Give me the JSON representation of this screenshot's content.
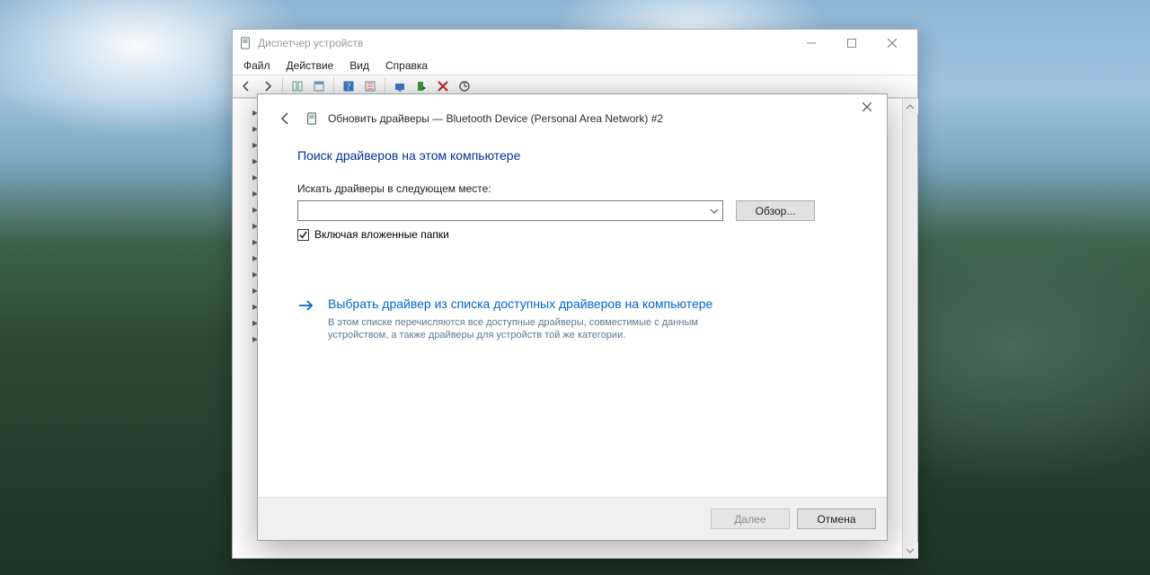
{
  "devmgr": {
    "title": "Диспетчер устройств",
    "menu": {
      "file": "Файл",
      "action": "Действие",
      "view": "Вид",
      "help": "Справка"
    }
  },
  "modal": {
    "header_prefix": "Обновить драйверы — ",
    "device_name": "Bluetooth Device (Personal Area Network) #2",
    "section_title": "Поиск драйверов на этом компьютере",
    "path_label": "Искать драйверы в следующем месте:",
    "path_value": "",
    "browse_label": "Обзор...",
    "include_subfolders_label": "Включая вложенные папки",
    "include_subfolders_checked": true,
    "option_title": "Выбрать драйвер из списка доступных драйверов на компьютере",
    "option_desc": "В этом списке перечисляются все доступные драйверы, совместимые с данным устройством, а также драйверы для устройств той же категории.",
    "next_label": "Далее",
    "cancel_label": "Отмена",
    "next_enabled": false
  }
}
